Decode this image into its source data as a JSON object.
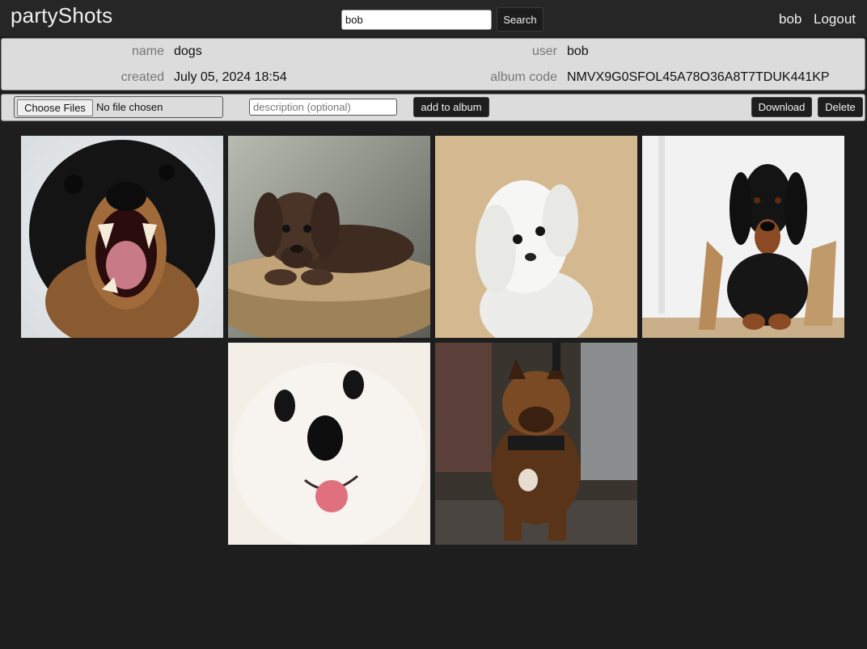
{
  "header": {
    "brand": "partyShots",
    "search": {
      "value": "bob",
      "button_label": "Search"
    },
    "user": "bob",
    "logout_label": "Logout"
  },
  "album": {
    "name_label": "name",
    "name": "dogs",
    "created_label": "created",
    "created": "July 05, 2024 18:54",
    "user_label": "user",
    "user": "bob",
    "code_label": "album code",
    "code": "NMVX9G0SFOL45A78O36A8T7TDUK441KP"
  },
  "upload": {
    "choose_label": "Choose Files",
    "file_status": "No file chosen",
    "description_placeholder": "description (optional)",
    "add_label": "add to album",
    "download_label": "Download",
    "delete_label": "Delete"
  },
  "photos": [
    {
      "subject": "black-and-tan chihuahua snarling"
    },
    {
      "subject": "chocolate labrador puppy on cushion"
    },
    {
      "subject": "white maltese tilting head"
    },
    {
      "subject": "black-and-tan dachshund through torn paper"
    },
    {
      "subject": "white pomeranian with tongue out"
    },
    {
      "subject": "brown pit bull standing outdoors"
    }
  ],
  "colors": {
    "page_bg": "#1e1e1e",
    "topbar_bg": "#262626",
    "panel_bg": "#dcdcdc"
  }
}
